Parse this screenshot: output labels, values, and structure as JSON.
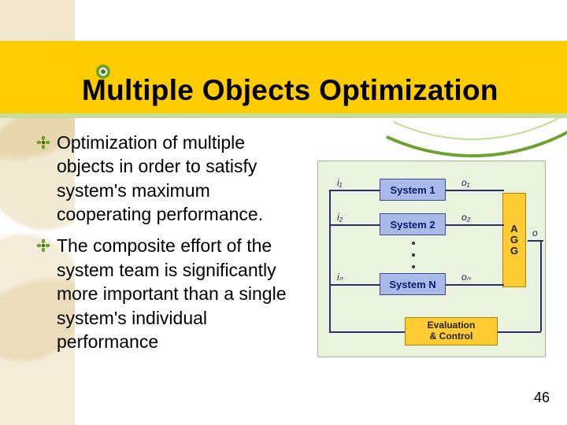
{
  "title": "Multiple Objects Optimization",
  "bullets": [
    "Optimization of multiple objects in order to satisfy system's maximum cooperating performance.",
    "The composite effort of the system team is significantly more important than a single system's individual performance"
  ],
  "diagram": {
    "systems": [
      "System 1",
      "System 2",
      "System N"
    ],
    "agg": "A\nG\nG",
    "eval": "Evaluation\n& Control",
    "inputs": [
      "i₁",
      "i₂",
      "iₙ"
    ],
    "outputs": [
      "o₁",
      "o₂",
      "oₙ"
    ],
    "agg_out": "o"
  },
  "page": "46"
}
